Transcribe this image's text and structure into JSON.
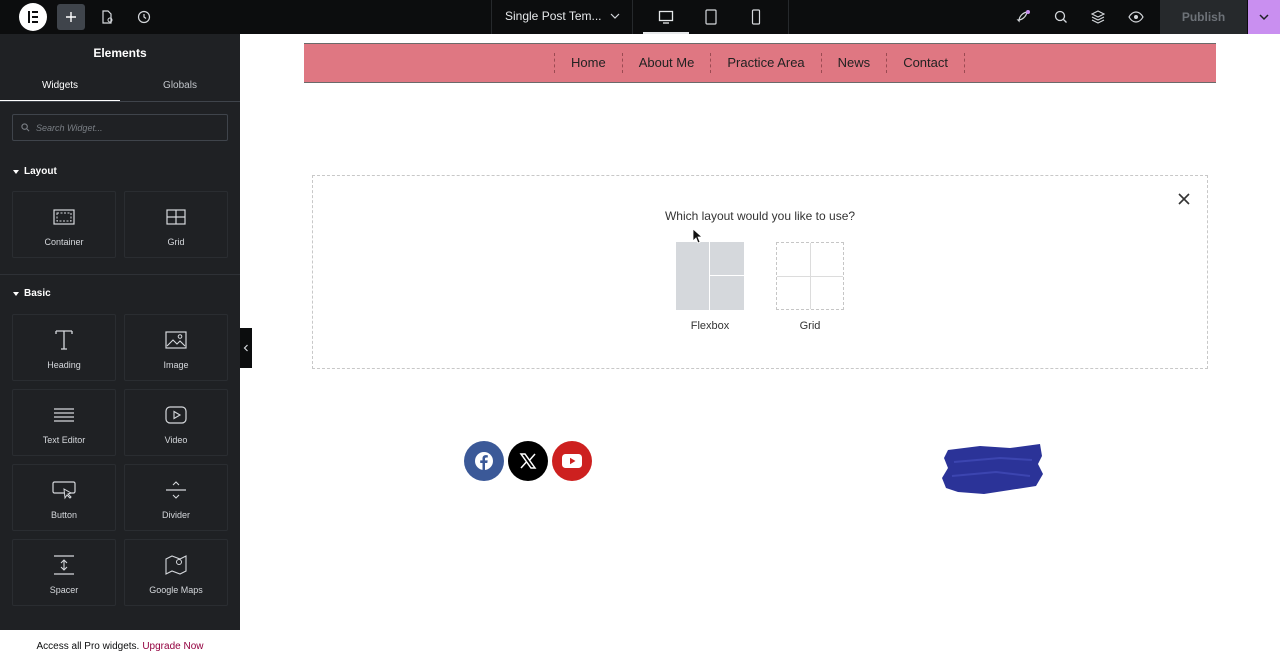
{
  "topbar": {
    "template_title": "Single Post Tem...",
    "publish_label": "Publish"
  },
  "panel": {
    "title": "Elements",
    "tabs": [
      "Widgets",
      "Globals"
    ],
    "search_placeholder": "Search Widget...",
    "categories": {
      "layout": "Layout",
      "basic": "Basic"
    },
    "layout_widgets": [
      "Container",
      "Grid"
    ],
    "basic_widgets": [
      "Heading",
      "Image",
      "Text Editor",
      "Video",
      "Button",
      "Divider",
      "Spacer",
      "Google Maps"
    ],
    "pro_text": "Access all Pro widgets.",
    "pro_link": "Upgrade Now"
  },
  "canvas": {
    "nav_links": [
      "Home",
      "About Me",
      "Practice Area",
      "News",
      "Contact"
    ],
    "layout_prompt": "Which layout would you like to use?",
    "layout_options": [
      "Flexbox",
      "Grid"
    ],
    "social_icons": [
      "facebook-icon",
      "x-icon",
      "youtube-icon"
    ]
  },
  "colors": {
    "nav_background": "#df7782",
    "publish_accent": "#c98ff0",
    "facebook": "#3b5998",
    "x": "#000000",
    "youtube": "#cd201f",
    "brush": "#2b3398",
    "upgrade_link": "#93003f"
  }
}
